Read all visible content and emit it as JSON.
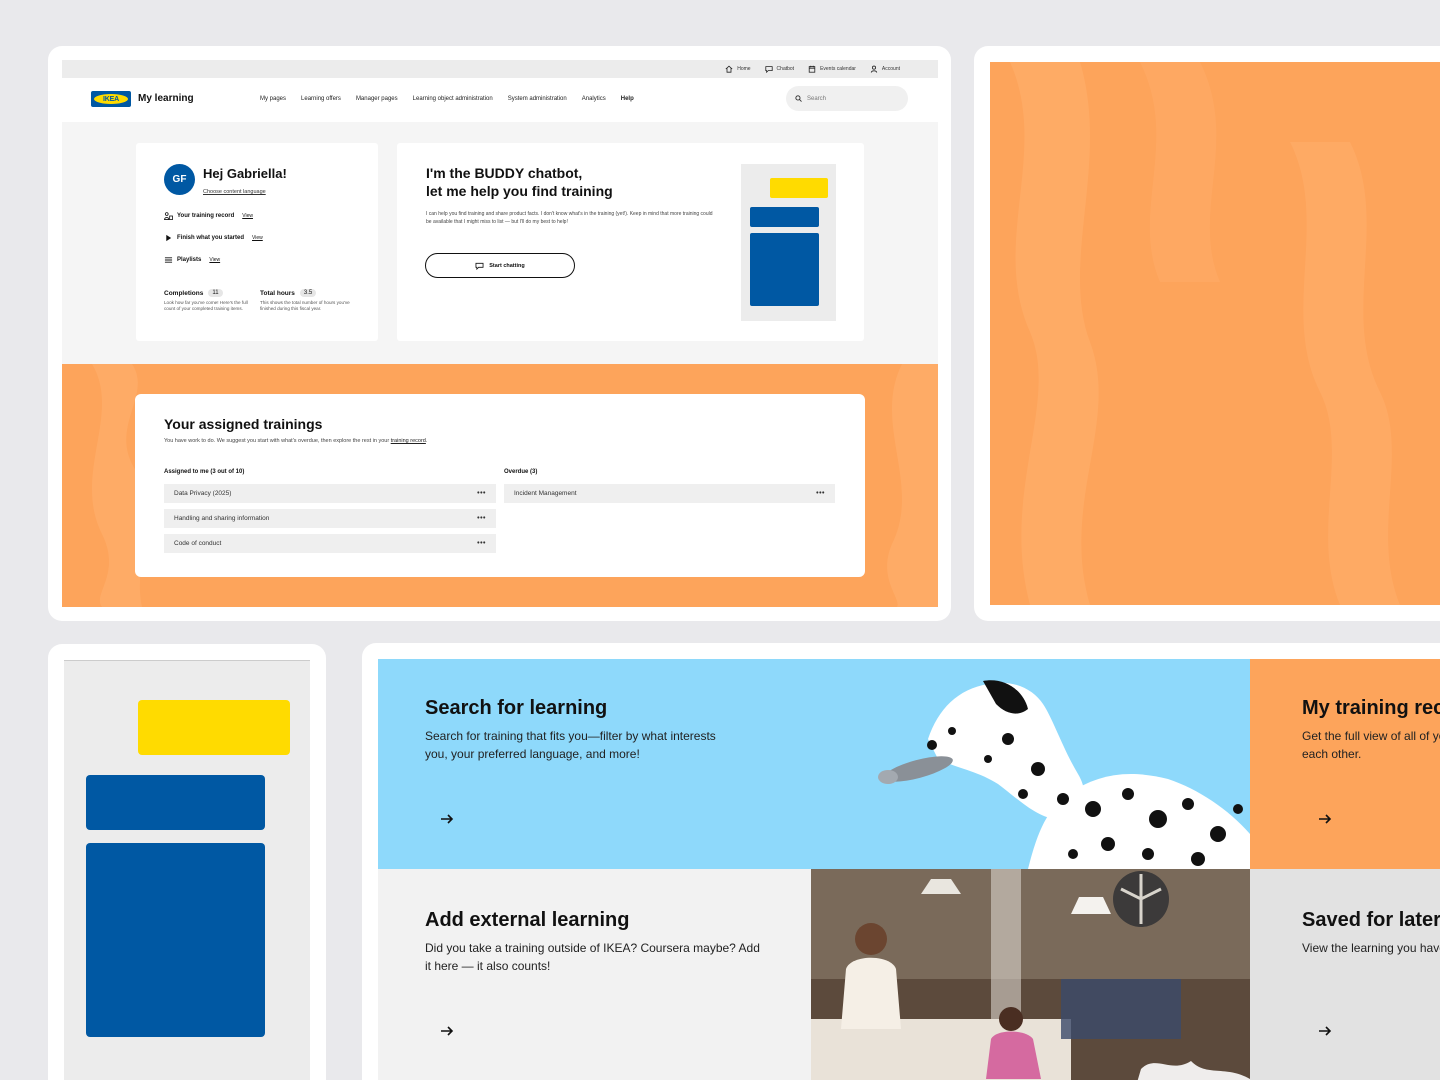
{
  "utility_bar": [
    {
      "label": "Home",
      "icon": "home-icon"
    },
    {
      "label": "Chatbot",
      "icon": "chat-icon"
    },
    {
      "label": "Events calendar",
      "icon": "calendar-icon"
    },
    {
      "label": "Account",
      "icon": "user-icon"
    }
  ],
  "header": {
    "logo_text": "IKEA",
    "brand": "My learning",
    "nav": [
      "My pages",
      "Learning offers",
      "Manager pages",
      "Learning object administration",
      "System administration",
      "Analytics",
      "Help"
    ],
    "search_placeholder": "Search"
  },
  "welcome": {
    "initials": "GF",
    "greeting": "Hej Gabriella!",
    "language_link": "Choose content language",
    "rows": [
      {
        "label": "Your training record",
        "link": "View",
        "icon": "people-icon"
      },
      {
        "label": "Finish what you started",
        "link": "View",
        "icon": "play-icon"
      },
      {
        "label": "Playlists",
        "link": "View",
        "icon": "list-icon"
      }
    ],
    "completions": {
      "label": "Completions",
      "value": "11",
      "desc": "Look how far you've come! Here's the full count of your completed training items."
    },
    "hours": {
      "label": "Total hours",
      "value": "3.5",
      "desc": "This shows the total number of hours you've finished during this fiscal year."
    }
  },
  "buddy": {
    "title_line1": "I'm the BUDDY chatbot,",
    "title_line2": "let me help you find training",
    "desc": "I can help you find training and share product facts. I don't know what's in the training (yet!). Keep in mind that more training could be available that I might miss to list — but I'll do my best to help!",
    "button": "Start chatting"
  },
  "assigned": {
    "title": "Your assigned trainings",
    "desc_prefix": "You have work to do. We suggest you start with what's overdue, then explore the rest in your ",
    "desc_link": "training record",
    "desc_suffix": ".",
    "assigned_header": "Assigned to me (3 out of 10)",
    "assigned_items": [
      "Data Privacy (2025)",
      "Handling and sharing information",
      "Code of conduct"
    ],
    "overdue_header": "Overdue (3)",
    "overdue_items": [
      "Incident Management"
    ],
    "more_label": "•••"
  },
  "tiles": {
    "search": {
      "title": "Search for learning",
      "desc": "Search for training that fits you—filter by what interests you, your preferred language, and more!"
    },
    "record": {
      "title": "My training record",
      "desc": "Get the full view of all of your training in one place, side by each other."
    },
    "external": {
      "title": "Add external learning",
      "desc": "Did you take a training outside of IKEA? Coursera maybe? Add it here — it also counts!"
    },
    "saved": {
      "title": "Saved for later",
      "desc": "View the learning you have saved."
    }
  },
  "colors": {
    "ikea_blue": "#0058a3",
    "ikea_yellow": "#ffdb00",
    "orange": "#fda45b",
    "sky": "#8ed9fb"
  }
}
